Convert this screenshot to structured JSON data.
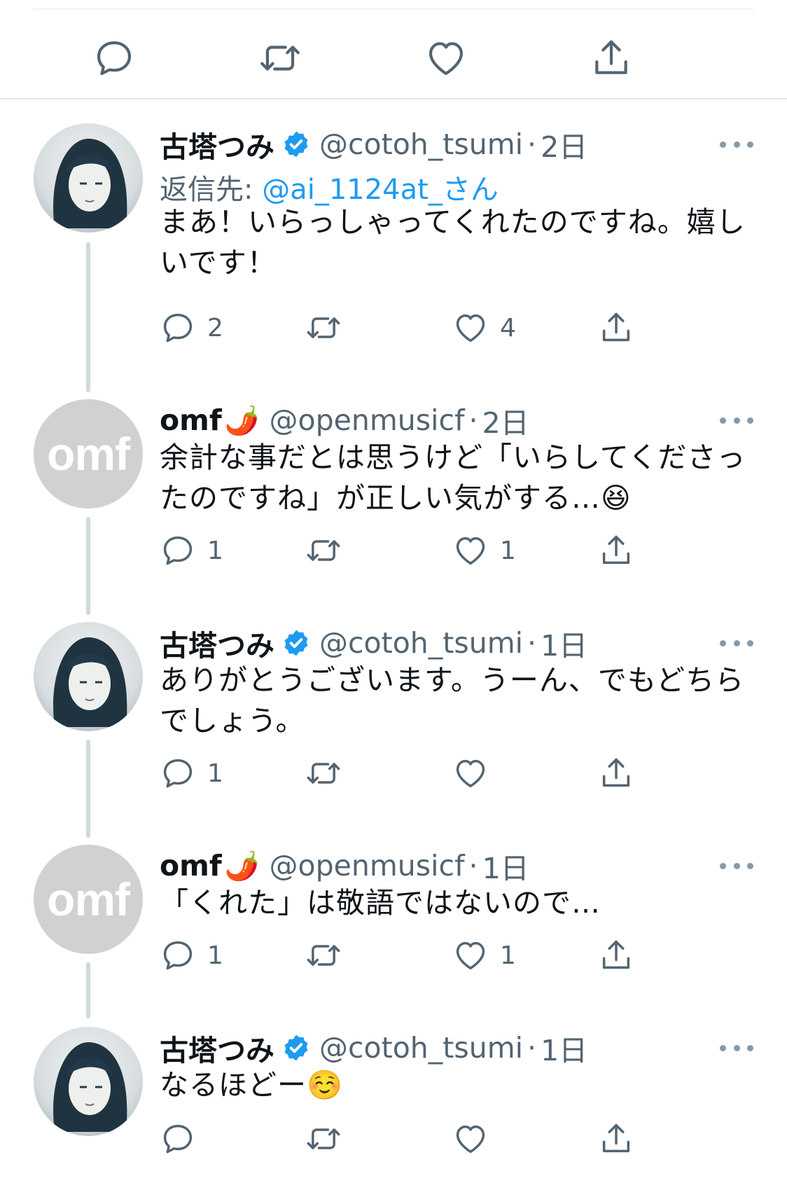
{
  "top_actions": [
    "reply-icon",
    "retweet-icon",
    "like-icon",
    "share-icon"
  ],
  "colors": {
    "accent": "#1d9bf0",
    "muted": "#536471",
    "verified": "#1d9bf0",
    "avatar_omf": "#d1d1d1"
  },
  "tweets": [
    {
      "name": "古塔つみ",
      "verified": true,
      "handle": "@cotoh_tsumi",
      "sep": "·",
      "time": "2日",
      "reply_prefix": "返信先: ",
      "reply_to": "@ai_1124at_さん",
      "text_lines": [
        "まあ！いらっしゃってくれたのですね。嬉し",
        "いです！"
      ],
      "reply_count": "2",
      "retweet_count": "",
      "like_count": "4"
    },
    {
      "name": "omf",
      "name_emoji": "🌶️",
      "avatar_text": "omf",
      "handle": "@openmusicf",
      "sep": "·",
      "time": "2日",
      "text_lines": [
        "余計な事だとは思うけど「いらしてくださっ",
        "たのですね」が正しい気がする…😆"
      ],
      "reply_count": "1",
      "retweet_count": "",
      "like_count": "1"
    },
    {
      "name": "古塔つみ",
      "verified": true,
      "handle": "@cotoh_tsumi",
      "sep": "·",
      "time": "1日",
      "text_lines": [
        "ありがとうございます。うーん、でもどちら",
        "でしょう。"
      ],
      "reply_count": "1",
      "retweet_count": "",
      "like_count": ""
    },
    {
      "name": "omf",
      "name_emoji": "🌶️",
      "avatar_text": "omf",
      "handle": "@openmusicf",
      "sep": "·",
      "time": "1日",
      "text_lines": [
        "「くれた」は敬語ではないので…"
      ],
      "reply_count": "1",
      "retweet_count": "",
      "like_count": "1"
    },
    {
      "name": "古塔つみ",
      "verified": true,
      "handle": "@cotoh_tsumi",
      "sep": "·",
      "time": "1日",
      "text_lines": [
        "なるほどー☺️"
      ],
      "reply_count": "",
      "retweet_count": "",
      "like_count": ""
    }
  ]
}
